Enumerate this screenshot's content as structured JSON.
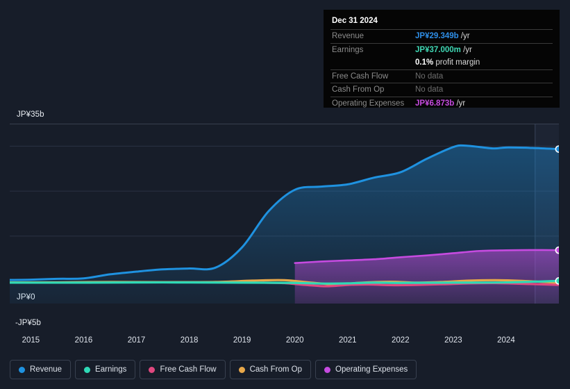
{
  "chart_data": {
    "type": "area",
    "title": "",
    "xlabel": "",
    "ylabel": "",
    "currency": "JP¥",
    "grid": true,
    "legend_position": "bottom-left",
    "ylim": [
      -5,
      35
    ],
    "xlim": [
      2014.6,
      2025.0
    ],
    "y_ticks": [
      {
        "value": 35,
        "label": "JP¥35b"
      },
      {
        "value": 0,
        "label": "JP¥0"
      },
      {
        "value": -5,
        "label": "-JP¥5b"
      }
    ],
    "x_ticks": [
      "2015",
      "2016",
      "2017",
      "2018",
      "2019",
      "2020",
      "2021",
      "2022",
      "2023",
      "2024"
    ],
    "series": [
      {
        "name": "Revenue",
        "color": "#1f92e0",
        "x": [
          2014.6,
          2015,
          2015.5,
          2016,
          2016.5,
          2017,
          2017.5,
          2018,
          2018.5,
          2019,
          2019.5,
          2020,
          2020.5,
          2021,
          2021.5,
          2022,
          2022.5,
          2023,
          2023.25,
          2023.75,
          2024,
          2024.5,
          2025
        ],
        "values": [
          0.25,
          0.3,
          0.5,
          0.6,
          1.5,
          2.1,
          2.6,
          2.8,
          3.0,
          7.5,
          15.5,
          20.3,
          21.0,
          21.5,
          23.0,
          24.2,
          27.2,
          29.8,
          30.1,
          29.5,
          29.7,
          29.6,
          29.349
        ]
      },
      {
        "name": "Earnings",
        "color": "#2fd9b6",
        "x": [
          2014.6,
          2016,
          2017.5,
          2019,
          2020,
          2020.5,
          2021,
          2021.5,
          2022,
          2023,
          2024,
          2025
        ],
        "values": [
          -0.35,
          -0.35,
          -0.3,
          -0.35,
          -0.4,
          -0.55,
          -0.5,
          -0.35,
          -0.4,
          -0.35,
          -0.3,
          0.037
        ]
      },
      {
        "name": "Free Cash Flow",
        "color": "#e0487f",
        "x": [
          2019.4,
          2019.8,
          2020.2,
          2020.6,
          2021,
          2021.4,
          2021.8,
          2022.3,
          2022.8,
          2023.3,
          2023.8,
          2024.3,
          2025
        ],
        "values": [
          -0.35,
          -0.45,
          -0.85,
          -1.15,
          -0.85,
          -0.75,
          -0.9,
          -0.85,
          -0.7,
          -0.5,
          -0.45,
          -0.6,
          -0.85
        ]
      },
      {
        "name": "Cash From Op",
        "color": "#e8a84a",
        "x": [
          2014.6,
          2015.5,
          2016.5,
          2017.5,
          2018.5,
          2019.2,
          2019.8,
          2020.3,
          2020.8,
          2021.2,
          2021.8,
          2022.3,
          2022.8,
          2023.3,
          2023.8,
          2024.3,
          2025
        ],
        "values": [
          -0.3,
          -0.3,
          -0.2,
          -0.25,
          -0.2,
          0.1,
          0.2,
          -0.35,
          -0.75,
          -0.4,
          -0.15,
          -0.35,
          -0.2,
          0.1,
          0.2,
          0.05,
          -0.4
        ]
      },
      {
        "name": "Operating Expenses",
        "color": "#c64be0",
        "x": [
          2020.0,
          2020.5,
          2021,
          2021.5,
          2022,
          2022.5,
          2023,
          2023.5,
          2024,
          2024.5,
          2025
        ],
        "values": [
          4.0,
          4.35,
          4.6,
          4.85,
          5.3,
          5.7,
          6.2,
          6.7,
          6.85,
          6.9,
          6.873
        ]
      }
    ],
    "forecast_start": 2024.55,
    "end_markers": [
      {
        "series": "Revenue",
        "value": 29.349
      },
      {
        "series": "Operating Expenses",
        "value": 6.873
      },
      {
        "series": "Earnings",
        "value": 0.037
      }
    ]
  },
  "tooltip": {
    "date": "Dec 31 2024",
    "rows": [
      {
        "key": "Revenue",
        "value": "JP¥29.349b",
        "unit": " /yr",
        "color": "rev",
        "nodata": false
      },
      {
        "key": "Earnings",
        "value": "JP¥37.000m",
        "unit": " /yr",
        "color": "earn",
        "nodata": false
      },
      {
        "key": "",
        "value": "0.1%",
        "unit": " profit margin",
        "color": "white",
        "nodata": false
      },
      {
        "key": "Free Cash Flow",
        "value": "No data",
        "unit": "",
        "color": "none",
        "nodata": true
      },
      {
        "key": "Cash From Op",
        "value": "No data",
        "unit": "",
        "color": "none",
        "nodata": true
      },
      {
        "key": "Operating Expenses",
        "value": "JP¥6.873b",
        "unit": " /yr",
        "color": "opex",
        "nodata": false
      }
    ]
  },
  "legend": {
    "items": [
      {
        "label": "Revenue",
        "color": "#1f92e0"
      },
      {
        "label": "Earnings",
        "color": "#2fd9b6"
      },
      {
        "label": "Free Cash Flow",
        "color": "#e0487f"
      },
      {
        "label": "Cash From Op",
        "color": "#e8a84a"
      },
      {
        "label": "Operating Expenses",
        "color": "#c64be0"
      }
    ]
  }
}
